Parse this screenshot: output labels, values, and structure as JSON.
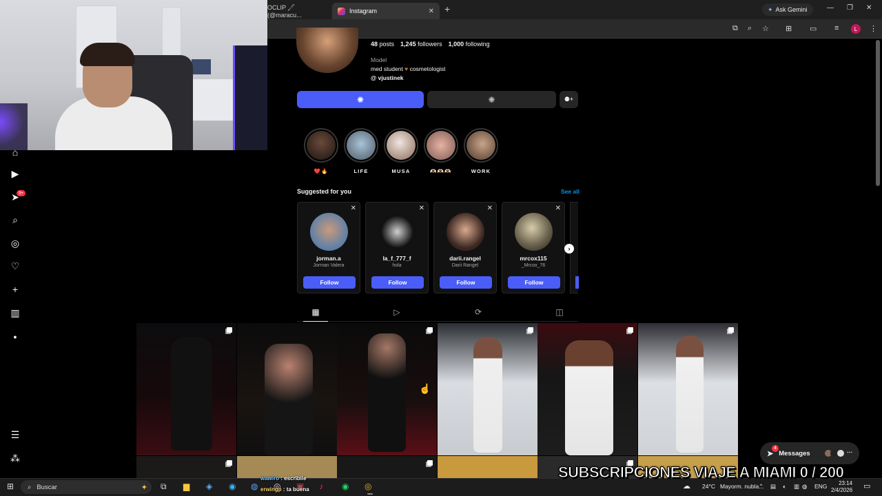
{
  "browser": {
    "tabs": [
      {
        "label": "OCLIP 🖋️ (@maracu..."
      },
      {
        "label": "Instagram"
      }
    ],
    "ask_gemini": "Ask Gemini",
    "profile_initial": "L"
  },
  "profile": {
    "stats": {
      "posts_count": "48",
      "posts_label": "posts",
      "followers_count": "1,245",
      "followers_label": "followers",
      "following_count": "1,000",
      "following_label": "following"
    },
    "category": "Model",
    "bio": {
      "text_a": "med student",
      "heart": "♥",
      "text_b": "cosmetologist"
    },
    "threads_handle": "vjustinek"
  },
  "highlights": [
    {
      "label": "❤️🔥"
    },
    {
      "label": "LIFE"
    },
    {
      "label": "MUSA"
    },
    {
      "label": "🫶🏻🫶🏻🫶🏻"
    },
    {
      "label": "WORK"
    }
  ],
  "suggested": {
    "title": "Suggested for you",
    "see_all": "See all",
    "cards": [
      {
        "username": "jorman.a",
        "name": "Jorman Valera",
        "follow": "Follow"
      },
      {
        "username": "la_f_777_f",
        "name": "hola",
        "follow": "Follow"
      },
      {
        "username": "darii.rangel",
        "name": "Darii Rangel",
        "follow": "Follow"
      },
      {
        "username": "mrcox115",
        "name": "_Mrcox_76",
        "follow": "Follow"
      }
    ]
  },
  "messages": {
    "label": "Messages",
    "badge": "4"
  },
  "nav": {
    "notification_badge": "9+"
  },
  "stream": {
    "overlay_text": "SUBSCRIPCIONES VIAJE A MIAMI 0 / 200",
    "chat": [
      {
        "user": "wawiro",
        "msg": "escribile"
      },
      {
        "user": "erwingp",
        "msg": "ta buena"
      }
    ]
  },
  "taskbar": {
    "search_placeholder": "Buscar",
    "weather": "24°C",
    "weather_desc": "Mayorm. nubla...",
    "lang": "ENG",
    "time": "23:14",
    "date": "2/4/2026"
  },
  "colors": {
    "accent": "#4a5df9",
    "link": "#0095f6",
    "badge": "#ff3040"
  }
}
